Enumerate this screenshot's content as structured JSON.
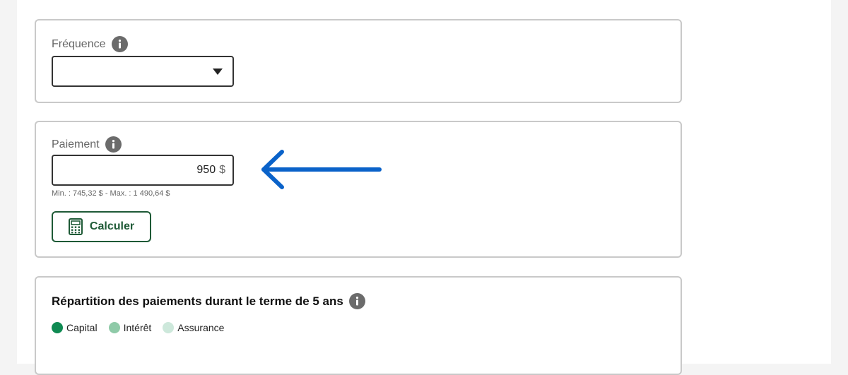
{
  "frequency": {
    "label": "Fréquence",
    "selected_value": ""
  },
  "payment": {
    "label": "Paiement",
    "value": "950",
    "unit": "$",
    "range_hint": "Min. : 745,32 $ - Max. : 1 490,64 $",
    "calculate_label": "Calculer"
  },
  "breakdown": {
    "title": "Répartition des paiements durant le terme de 5 ans",
    "legend": [
      {
        "label": "Capital",
        "color": "#0f8a52"
      },
      {
        "label": "Intérêt",
        "color": "#8fcaa8"
      },
      {
        "label": "Assurance",
        "color": "#cde8db"
      }
    ]
  },
  "annotation": {
    "arrow_color": "#0a62c9"
  }
}
